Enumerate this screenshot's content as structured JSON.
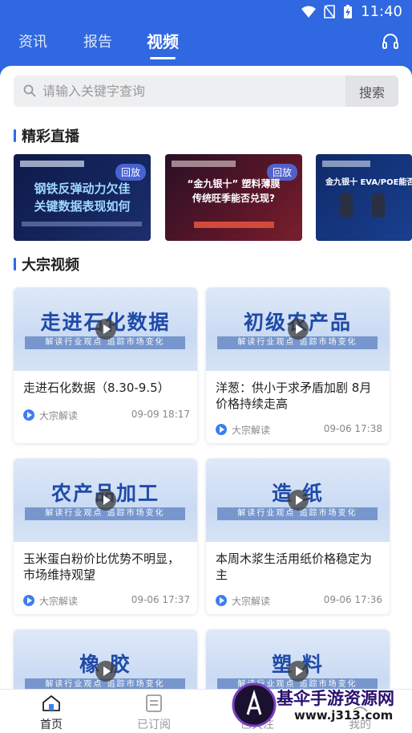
{
  "status_bar": {
    "time": "11:40"
  },
  "tabs": [
    {
      "label": "资讯",
      "active": false
    },
    {
      "label": "报告",
      "active": false
    },
    {
      "label": "视频",
      "active": true
    }
  ],
  "search": {
    "placeholder": "请输入关键字查询",
    "button_label": "搜索"
  },
  "sections": {
    "live": "精彩直播",
    "videos": "大宗视频"
  },
  "live_cards": [
    {
      "badge": "回放",
      "headline_1": "钢铁反弹动力欠佳",
      "headline_2": "关键数据表现如何"
    },
    {
      "badge": "回放",
      "headline_1": "“金九银十” 塑料薄膜",
      "headline_2": "传统旺季能否兑现?"
    },
    {
      "badge": "",
      "headline_1": "金九银十 EVA/POE能否"
    }
  ],
  "videos": [
    {
      "thumb_title": "走进石化数据",
      "thumb_sub": "解读行业观点  追踪市场变化",
      "title": "走进石化数据（8.30-9.5）",
      "source": "大宗解读",
      "time": "09-09 18:17"
    },
    {
      "thumb_title": "初级农产品",
      "thumb_sub": "解读行业观点  追踪市场变化",
      "title": "洋葱：供小于求矛盾加剧 8月价格持续走高",
      "source": "大宗解读",
      "time": "09-06 17:38"
    },
    {
      "thumb_title": "农产品加工",
      "thumb_sub": "解读行业观点  追踪市场变化",
      "title": "玉米蛋白粉价比优势不明显，市场维持观望",
      "source": "大宗解读",
      "time": "09-06 17:37"
    },
    {
      "thumb_title": "造 纸",
      "thumb_sub": "解读行业观点  追踪市场变化",
      "title": "本周木浆生活用纸价格稳定为主",
      "source": "大宗解读",
      "time": "09-06 17:36"
    },
    {
      "thumb_title": "橡 胶",
      "thumb_sub": "解读行业观点  追踪市场变化"
    },
    {
      "thumb_title": "塑 料",
      "thumb_sub": "解读行业观点  追踪市场变化"
    }
  ],
  "bottom_nav": [
    {
      "label": "首页",
      "active": true
    },
    {
      "label": "已订阅",
      "active": false
    },
    {
      "label": "已关注",
      "active": false
    },
    {
      "label": "我的",
      "active": false
    }
  ],
  "watermark": {
    "line1": "基伞手游资源网",
    "line2": "www.j313.com"
  },
  "colors": {
    "brand_blue": "#2f68e0",
    "background": "#f4f5f7"
  }
}
